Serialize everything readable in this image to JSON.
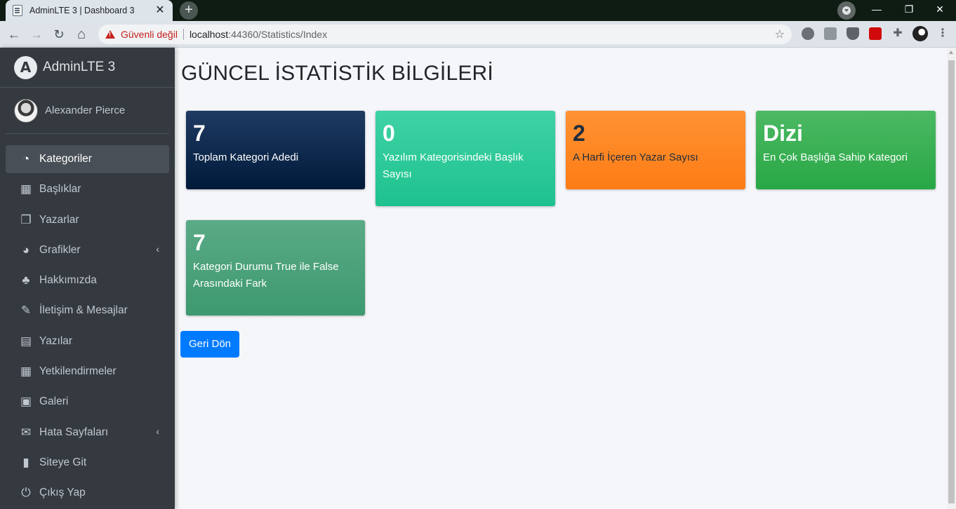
{
  "browser": {
    "tab_title": "AdminLTE 3 | Dashboard 3",
    "tab_close": "✕",
    "new_tab": "+",
    "win_minimize": "—",
    "win_restore": "❐",
    "win_close": "✕",
    "back": "←",
    "forward": "→",
    "reload": "↻",
    "home": "⌂",
    "security_text": "Güvenli değil",
    "url_host": "localhost",
    "url_path": ":44360/Statistics/Index",
    "star": "☆"
  },
  "sidebar": {
    "brand_initial": "A",
    "brand_text": "AdminLTE 3",
    "user_name": "Alexander Pierce",
    "items": [
      {
        "label": "Kategoriler",
        "icon": "tachometer-icon",
        "glyph": "◔",
        "active": true
      },
      {
        "label": "Başlıklar",
        "icon": "grid-icon",
        "glyph": "▦"
      },
      {
        "label": "Yazarlar",
        "icon": "copy-icon",
        "glyph": "❐"
      },
      {
        "label": "Grafikler",
        "icon": "pie-chart-icon",
        "glyph": "◕",
        "chevron": "‹"
      },
      {
        "label": "Hakkımızda",
        "icon": "tree-icon",
        "glyph": "♣"
      },
      {
        "label": "İletişim & Mesajlar",
        "icon": "edit-icon",
        "glyph": "✎"
      },
      {
        "label": "Yazılar",
        "icon": "table-icon",
        "glyph": "▤"
      },
      {
        "label": "Yetkilendirmeler",
        "icon": "calendar-icon",
        "glyph": "▦"
      },
      {
        "label": "Galeri",
        "icon": "image-icon",
        "glyph": "▣"
      },
      {
        "label": "Hata Sayfaları",
        "icon": "envelope-icon",
        "glyph": "✉",
        "chevron": "‹"
      },
      {
        "label": "Siteye Git",
        "icon": "book-icon",
        "glyph": "▮"
      },
      {
        "label": "Çıkış Yap",
        "icon": "power-icon",
        "glyph": "⏻"
      }
    ]
  },
  "main": {
    "title": "GÜNCEL İSTATİSTİK BİLGİLERİ",
    "boxes": [
      {
        "value": "7",
        "label": "Toplam Kategori Adedi"
      },
      {
        "value": "0",
        "label": "Yazılım Kategorisindeki Başlık Sayısı"
      },
      {
        "value": "2",
        "label": "A Harfi İçeren Yazar Sayısı"
      },
      {
        "value": "Dizi",
        "label": "En Çok Başlığa Sahip Kategori"
      },
      {
        "value": "7",
        "label": "Kategori Durumu True ile False Arasındaki Fark"
      }
    ],
    "back_button": "Geri Dön"
  },
  "colors": {
    "sidebar_bg": "#343a40",
    "box_navy": "#001f3f",
    "box_teal": "#20c997",
    "box_orange": "#fd7e14",
    "box_green": "#28a745",
    "box_olive": "#3d9970",
    "primary": "#007bff"
  }
}
